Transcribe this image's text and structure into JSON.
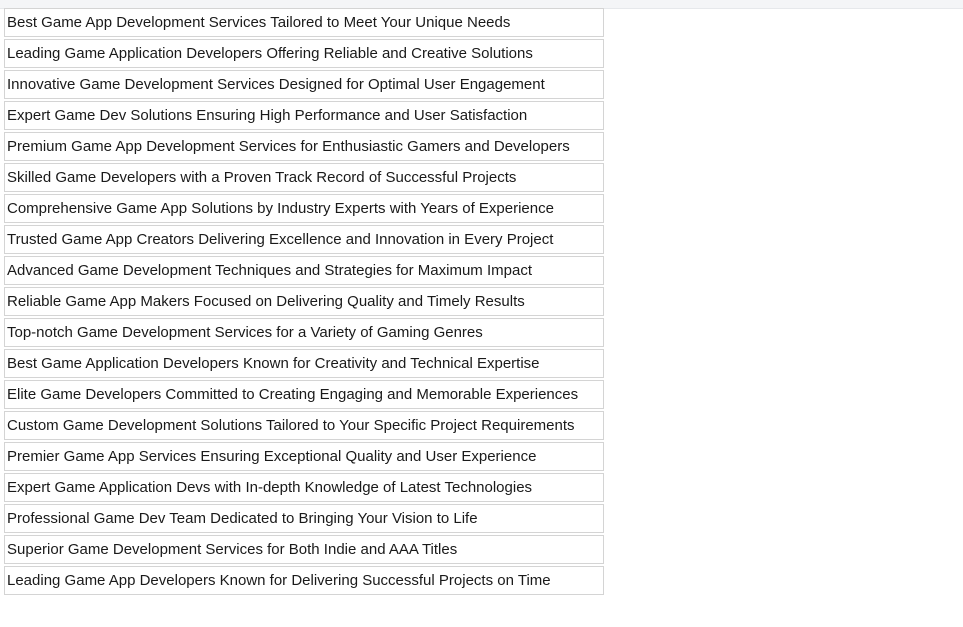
{
  "table": {
    "rows": [
      "Best Game App Development Services Tailored to Meet Your Unique Needs",
      "Leading Game Application Developers Offering Reliable and Creative Solutions",
      "Innovative Game Development Services Designed for Optimal User Engagement",
      "Expert Game Dev Solutions Ensuring High Performance and User Satisfaction",
      "Premium Game App Development Services for Enthusiastic Gamers and Developers",
      "Skilled Game Developers with a Proven Track Record of Successful Projects",
      "Comprehensive Game App Solutions by Industry Experts with Years of Experience",
      "Trusted Game App Creators Delivering Excellence and Innovation in Every Project",
      "Advanced Game Development Techniques and Strategies for Maximum Impact",
      "Reliable Game App Makers Focused on Delivering Quality and Timely Results",
      "Top-notch Game Development Services for a Variety of Gaming Genres",
      "Best Game Application Developers Known for Creativity and Technical Expertise",
      "Elite Game Developers Committed to Creating Engaging and Memorable Experiences",
      "Custom Game Development Solutions Tailored to Your Specific Project Requirements",
      "Premier Game App Services Ensuring Exceptional Quality and User Experience",
      "Expert Game Application Devs with In-depth Knowledge of Latest Technologies",
      "Professional Game Dev Team Dedicated to Bringing Your Vision to Life",
      "Superior Game Development Services for Both Indie and AAA Titles",
      "Leading Game App Developers Known for Delivering Successful Projects on Time"
    ]
  }
}
